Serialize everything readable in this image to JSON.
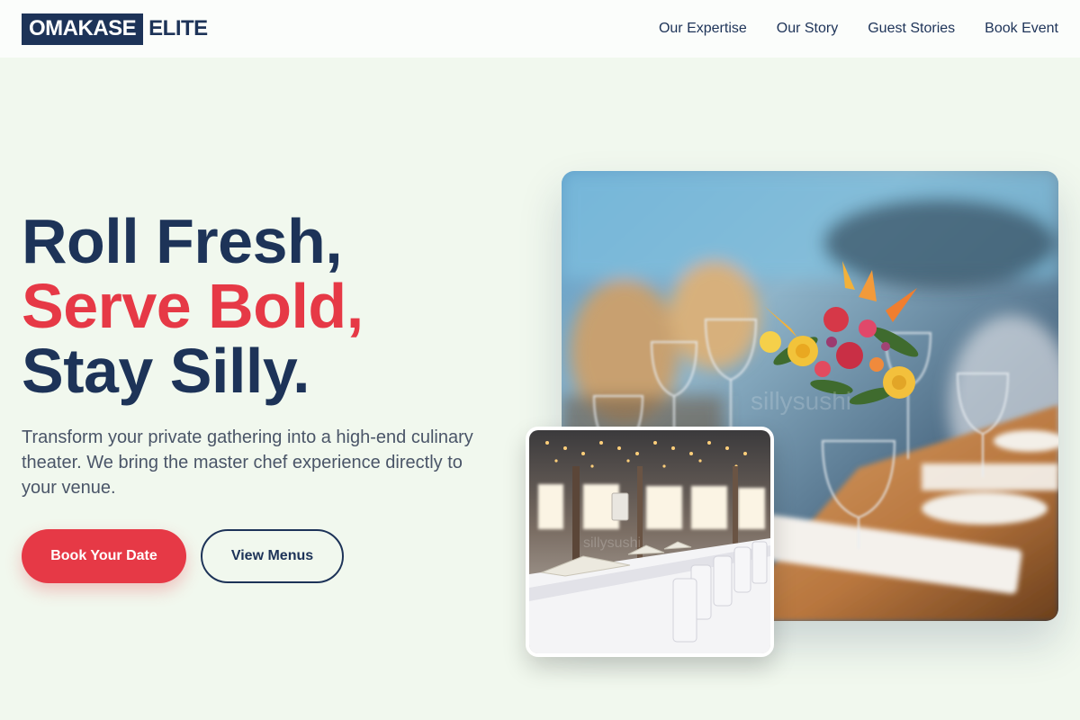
{
  "brand": {
    "logo_box": "OMAKASE",
    "logo_rest": "ELITE"
  },
  "nav": {
    "items": [
      {
        "label": "Our Expertise"
      },
      {
        "label": "Our Story"
      },
      {
        "label": "Guest Stories"
      },
      {
        "label": "Book Event"
      }
    ]
  },
  "hero": {
    "title_line1": "Roll Fresh,",
    "title_line2": "Serve Bold,",
    "title_line3": "Stay Silly.",
    "description": "Transform your private gathering into a high-end culinary theater. We bring the master chef experience directly to your venue.",
    "primary_button": "Book Your Date",
    "secondary_button": "View Menus"
  },
  "images": {
    "main": "table-centerpiece-photo",
    "secondary": "banquet-hall-photo"
  },
  "colors": {
    "navy": "#1d3358",
    "accent": "#e63946",
    "background": "#f1f8ee",
    "header_bg": "#fbfdfb",
    "body_text": "#4a5568"
  }
}
